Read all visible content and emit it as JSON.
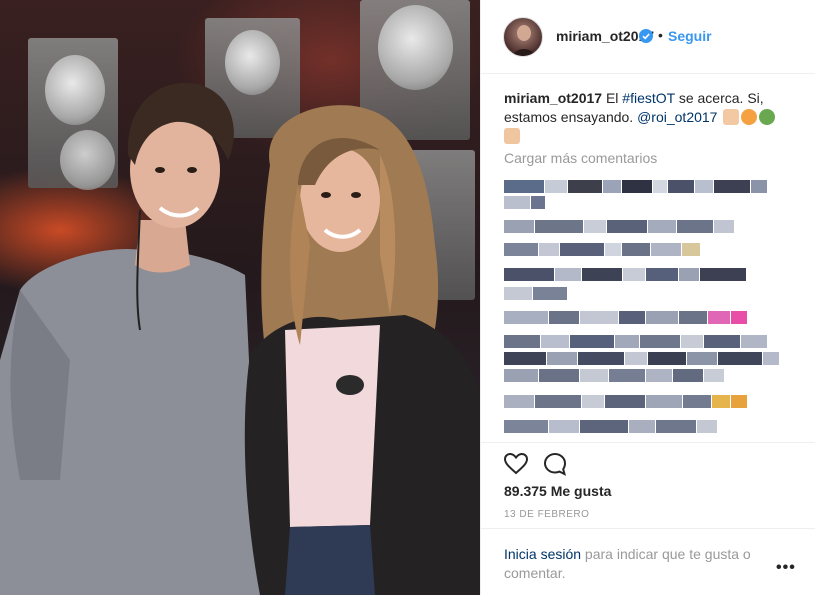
{
  "post": {
    "username": "miriam_ot2017",
    "follow_label": "Seguir",
    "dot": "•",
    "caption": {
      "username": "miriam_ot2017",
      "text_before_tag": " El ",
      "hashtag": "#fiestOT",
      "text_after_tag": " se acerca. Si, estamos ensayando. ",
      "mention": "@roi_ot2017"
    },
    "load_more_label": "Cargar más comentarios",
    "likes": "89.375 Me gusta",
    "date": "13 DE FEBRERO",
    "login": {
      "link": "Inicia sesión",
      "rest": " para indicar que te gusta o comentar."
    },
    "options_label": "•••"
  },
  "colors": {
    "accent": "#3897f0",
    "link": "#003569",
    "muted": "#999999",
    "text": "#262626",
    "border": "#efefef"
  },
  "icons": [
    "verified-badge-icon",
    "heart-icon",
    "comment-bubble-icon",
    "more-options-icon"
  ]
}
